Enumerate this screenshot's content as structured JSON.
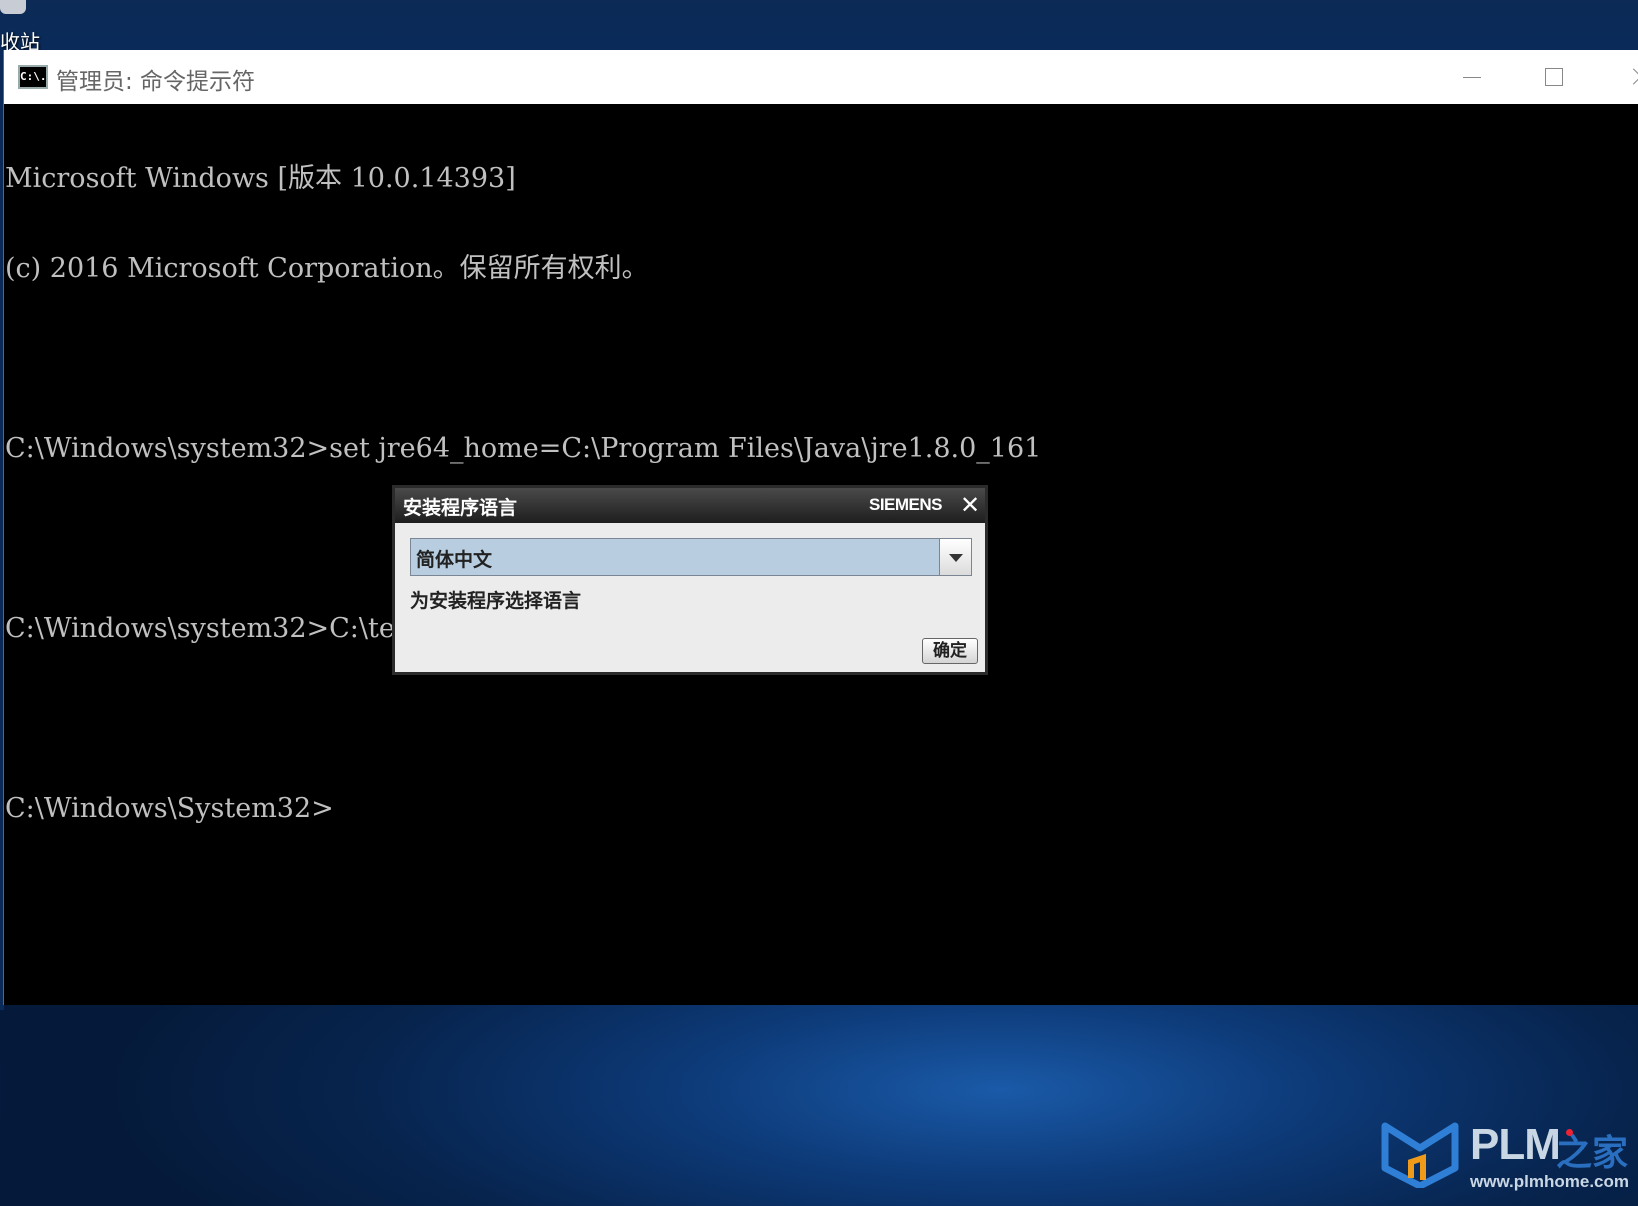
{
  "desktop": {
    "icon_label": "收站"
  },
  "window": {
    "title": "管理员: 命令提示符",
    "icon_text": "C:\\."
  },
  "console": {
    "lines": [
      "Microsoft Windows [版本 10.0.14393]",
      "(c) 2016 Microsoft Corporation。保留所有权利。",
      "",
      "C:\\Windows\\system32>set jre64_home=C:\\Program Files\\Java\\jre1.8.0_161",
      "",
      "C:\\Windows\\system32>C:\\temp\\Tc12.0.0.0_wntx64_1_of_2\\tem.bat",
      "",
      "C:\\Windows\\System32>"
    ]
  },
  "dialog": {
    "title": "安装程序语言",
    "brand": "SIEMENS",
    "close_glyph": "✕",
    "language_selected": "简体中文",
    "hint": "为安装程序选择语言",
    "ok_label": "确定"
  },
  "watermark": {
    "brand": "PLM",
    "brand_cn": "之家",
    "url": "www.plmhome.com"
  },
  "colors": {
    "console_text": "#c0c0c0",
    "console_bg": "#000000",
    "select_bg": "#b8cde0",
    "desktop_blue": "#0d3a78"
  }
}
